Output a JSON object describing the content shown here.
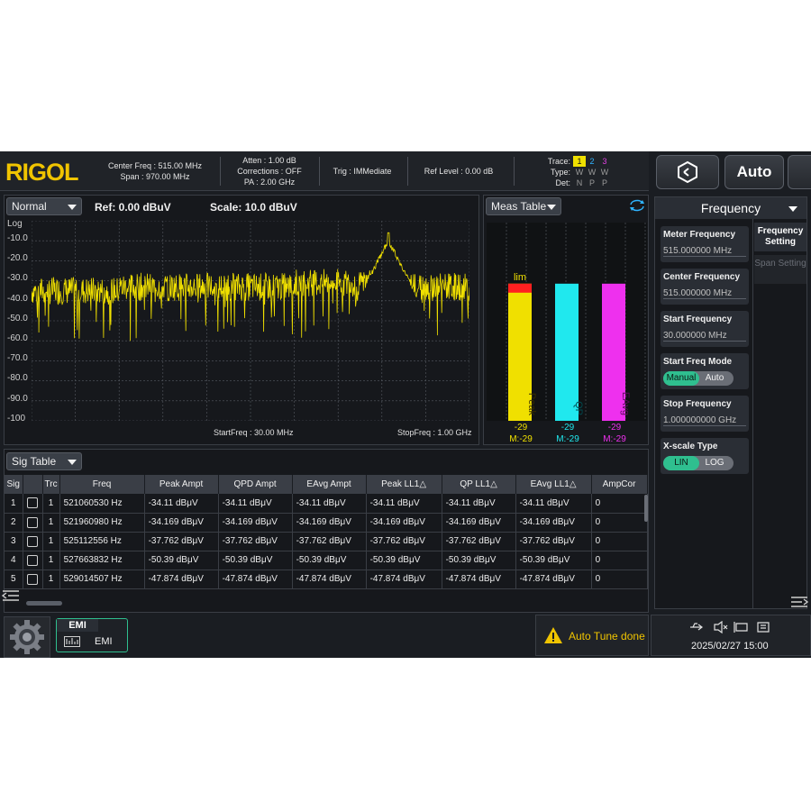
{
  "topbar": {
    "brand": "RIGOL",
    "center_freq": "Center Freq : 515.00 MHz",
    "span": "Span : 970.00 MHz",
    "atten": "Atten : 1.00 dB",
    "corrections": "Corrections : OFF",
    "pa": "PA : 2.00 GHz",
    "trig": "Trig : IMMediate",
    "ref_level": "Ref Level : 0.00 dB",
    "trace_label": "Trace:",
    "type_label": "Type:",
    "det_label": "Det:",
    "traces": [
      "1",
      "2",
      "3"
    ],
    "types": [
      "W",
      "W",
      "W"
    ],
    "dets": [
      "N",
      "P",
      "P"
    ],
    "auto_button": "Auto",
    "colors": {
      "trace1": "#f0e000",
      "trace2": "#2fb4ff",
      "trace3": "#e040e0"
    }
  },
  "graph": {
    "mode": "Normal",
    "ref": "Ref: 0.00 dBuV",
    "scale": "Scale:  10.0 dBuV",
    "log_label": "Log",
    "yticks": [
      "-10.0",
      "-20.0",
      "-30.0",
      "-40.0",
      "-50.0",
      "-60.0",
      "-70.0",
      "-80.0",
      "-90.0",
      "-100"
    ],
    "start_freq": "StartFreq : 30.00 MHz",
    "stop_freq": "StopFreq : 1.00 GHz",
    "trace_color": "#f0e000"
  },
  "meas": {
    "title": "Meas Table",
    "lim_label": "lim",
    "bars": [
      {
        "name": "Peak",
        "value": "-29",
        "marker": "M:-29",
        "level_db": -29,
        "color": "#f0e000"
      },
      {
        "name": "QP",
        "value": "-29",
        "marker": "M:-29",
        "level_db": -29,
        "color": "#20e8ee"
      },
      {
        "name": "EAvg",
        "value": "-29",
        "marker": "M:-29",
        "level_db": -29,
        "color": "#ee30ee"
      }
    ],
    "limit_color": "#ff2020"
  },
  "sig_table": {
    "title": "Sig Table",
    "columns": [
      "Sig",
      "",
      "Trc",
      "Freq",
      "Peak Ampt",
      "QPD Ampt",
      "EAvg Ampt",
      "Peak LL1△",
      "QP LL1△",
      "EAvg LL1△",
      "AmpCor"
    ],
    "rows": [
      [
        "1",
        "1",
        "521060530 Hz",
        "-34.11 dBμV",
        "-34.11 dBμV",
        "-34.11 dBμV",
        "-34.11 dBμV",
        "-34.11 dBμV",
        "-34.11 dBμV",
        "0"
      ],
      [
        "2",
        "1",
        "521960980 Hz",
        "-34.169 dBμV",
        "-34.169 dBμV",
        "-34.169 dBμV",
        "-34.169 dBμV",
        "-34.169 dBμV",
        "-34.169 dBμV",
        "0"
      ],
      [
        "3",
        "1",
        "525112556 Hz",
        "-37.762 dBμV",
        "-37.762 dBμV",
        "-37.762 dBμV",
        "-37.762 dBμV",
        "-37.762 dBμV",
        "-37.762 dBμV",
        "0"
      ],
      [
        "4",
        "1",
        "527663832 Hz",
        "-50.39 dBμV",
        "-50.39 dBμV",
        "-50.39 dBμV",
        "-50.39 dBμV",
        "-50.39 dBμV",
        "-50.39 dBμV",
        "0"
      ],
      [
        "5",
        "1",
        "529014507 Hz",
        "-47.874 dBμV",
        "-47.874 dBμV",
        "-47.874 dBμV",
        "-47.874 dBμV",
        "-47.874 dBμV",
        "-47.874 dBμV",
        "0"
      ]
    ]
  },
  "panel": {
    "title": "Frequency",
    "meter_freq": {
      "label": "Meter Frequency",
      "value": "515.000000 MHz"
    },
    "center_freq": {
      "label": "Center Frequency",
      "value": "515.000000 MHz"
    },
    "start_freq": {
      "label": "Start Frequency",
      "value": "30.000000 MHz"
    },
    "start_mode": {
      "label": "Start Freq Mode",
      "on": "Manual",
      "off": "Auto"
    },
    "stop_freq": {
      "label": "Stop Frequency",
      "value": "1.000000000 GHz"
    },
    "xscale": {
      "label": "X-scale Type",
      "on": "LIN",
      "off": "LOG"
    },
    "tab_freq_setting": "Frequency Setting",
    "tab_span_setting": "Span Setting",
    "accent": "#2fbf8f"
  },
  "bottom": {
    "emi_tab": "EMI",
    "emi_label": "EMI",
    "status": "Auto Tune done",
    "datetime": "2025/02/27  15:00"
  }
}
